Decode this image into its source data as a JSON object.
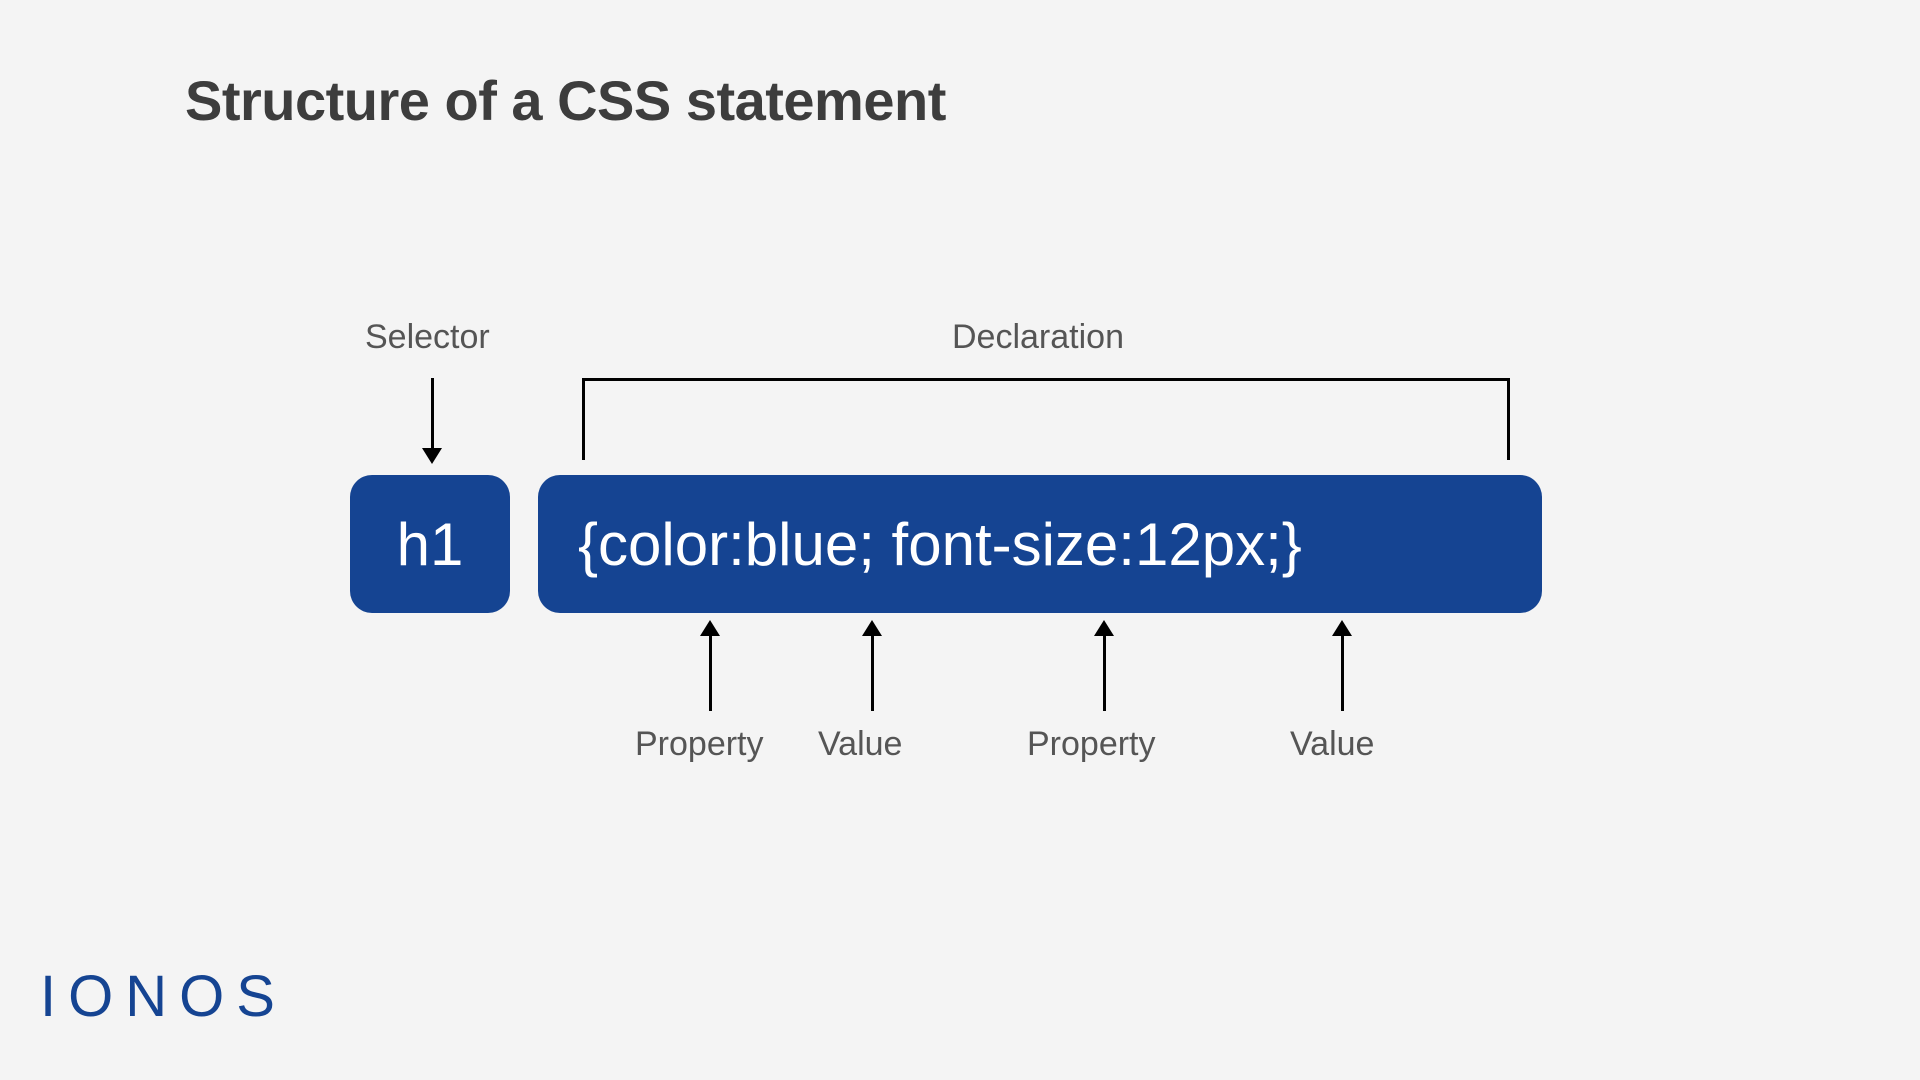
{
  "title": "Structure of a CSS statement",
  "labels": {
    "selector": "Selector",
    "declaration": "Declaration",
    "property1": "Property",
    "value1": "Value",
    "property2": "Property",
    "value2": "Value"
  },
  "boxes": {
    "selector": "h1",
    "declaration": "{color:blue; font-size:12px;}"
  },
  "brand": "IONOS"
}
